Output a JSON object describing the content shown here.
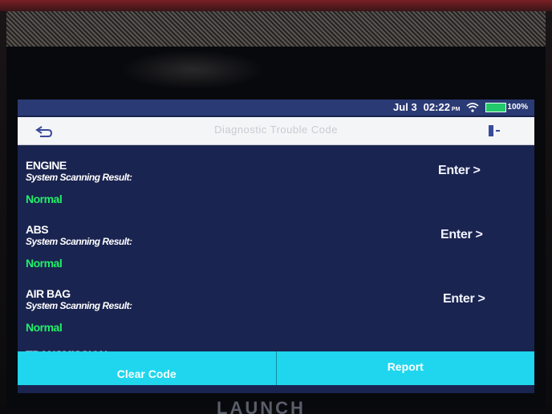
{
  "status_bar": {
    "date": "Jul 3",
    "time": "02:22",
    "ampm": "PM",
    "battery": "100%"
  },
  "header": {
    "title": "Diagnostic Trouble Code",
    "back_icon": "back-arrow-icon",
    "exit_icon": "exit-icon"
  },
  "systems": [
    {
      "name": "ENGINE",
      "scan_label": "System Scanning Result:",
      "status": "Normal",
      "enter_label": "Enter >"
    },
    {
      "name": "ABS",
      "scan_label": "System Scanning Result:",
      "status": "Normal",
      "enter_label": "Enter >"
    },
    {
      "name": "AIR BAG",
      "scan_label": "System Scanning Result:",
      "status": "Normal",
      "enter_label": "Enter >"
    }
  ],
  "partial_item": "TRANSMISSION",
  "actions": {
    "clear_code": "Clear Code",
    "report": "Report"
  },
  "device_brand": "LAUNCH",
  "colors": {
    "screen_bg": "#1a2450",
    "status_green": "#22f06a",
    "button_cyan": "#1fd6ee",
    "title_bar_bg": "#f4f5f7"
  }
}
